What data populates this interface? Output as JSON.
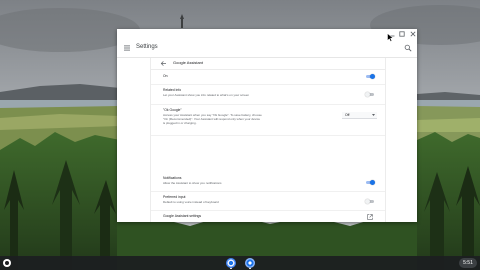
{
  "app": {
    "title": "Settings"
  },
  "page": {
    "title": "Google Assistant",
    "rows": [
      {
        "key": "assistant",
        "title": "On",
        "description": "",
        "control": "toggle",
        "checked": true
      },
      {
        "key": "related_info",
        "title": "Related info",
        "description": "Let your Assistant show you info related to what's on your screen",
        "control": "toggle",
        "checked": false
      },
      {
        "key": "ok_google",
        "title": "\"Ok Google\"",
        "description_lines": [
          "Access your Assistant when you say \"Ok Google\". To save battery, choose",
          "\"On (Recommended)\". Your Assistant will respond only when your device",
          "is plugged in or charging."
        ],
        "control": "select",
        "selected_value": "Off"
      },
      {
        "key": "notifications",
        "title": "Notifications",
        "description": "Allow the Assistant to show you notifications",
        "control": "toggle",
        "checked": true
      },
      {
        "key": "preferred_input",
        "title": "Preferred input",
        "description": "Default to using voice instead of keyboard",
        "control": "toggle",
        "checked": false
      },
      {
        "key": "assistant_settings",
        "title": "Google Assistant settings",
        "description": "",
        "control": "external-link"
      }
    ]
  },
  "shelf": {
    "time": "5:51",
    "apps": [
      "assistant-icon",
      "settings-icon"
    ]
  },
  "colors": {
    "accent": "#1a73e8",
    "toggle_on_track": "#9cbcf3",
    "toggle_off_track": "#bdc1c6",
    "shelf": "#1c1e21"
  },
  "icons": {
    "menu": "hamburger-menu-icon",
    "search": "search-icon",
    "back": "arrow-back-icon",
    "launch": "open-in-new-icon",
    "dropdown": "chevron-down-icon"
  }
}
